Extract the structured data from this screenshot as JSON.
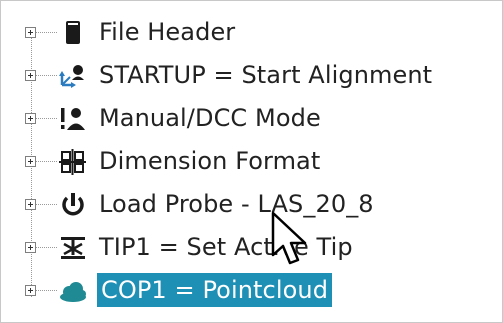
{
  "tree": {
    "items": [
      {
        "label": "File Header",
        "icon": "file-header-icon",
        "selected": false
      },
      {
        "label": "STARTUP = Start Alignment",
        "icon": "alignment-icon",
        "selected": false
      },
      {
        "label": "Manual/DCC Mode",
        "icon": "manual-mode-icon",
        "selected": false
      },
      {
        "label": "Dimension Format",
        "icon": "dimension-format-icon",
        "selected": false
      },
      {
        "label": "Load Probe - LAS_20_8",
        "icon": "load-probe-icon",
        "selected": false
      },
      {
        "label": "TIP1 = Set Active Tip",
        "icon": "set-tip-icon",
        "selected": false
      },
      {
        "label": "COP1 = Pointcloud",
        "icon": "pointcloud-icon",
        "selected": true
      }
    ]
  },
  "colors": {
    "selection_background": "#1e8fb5",
    "selection_text": "#ffffff",
    "text": "#222222",
    "icon_dark": "#1a1a1a",
    "icon_accent": "#2a7bbf",
    "cloud_teal": "#1f8a93"
  },
  "cursor": {
    "icon": "mouse-pointer-icon"
  }
}
